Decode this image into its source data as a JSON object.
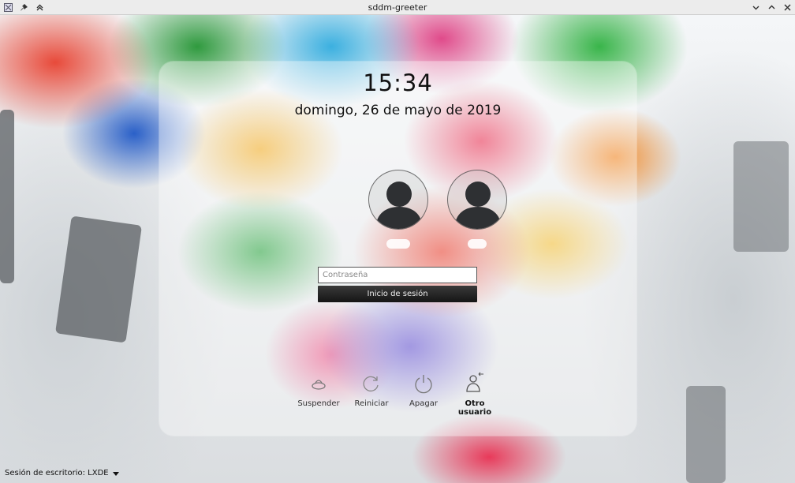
{
  "window": {
    "title": "sddm-greeter",
    "left_icons": [
      "app-menu-icon",
      "pin-icon",
      "keep-above-icon"
    ],
    "right_icons": [
      "minimize-chevron-icon",
      "maximize-chevron-icon",
      "close-icon"
    ]
  },
  "clock": {
    "time": "15:34",
    "date": "domingo, 26 de mayo de 2019"
  },
  "users": [
    {
      "icon": "user-avatar-icon",
      "name": ""
    },
    {
      "icon": "user-avatar-icon",
      "name": ""
    }
  ],
  "login": {
    "password_placeholder": "Contraseña",
    "password_value": "",
    "button_label": "Inicio de sesión"
  },
  "actions": [
    {
      "label": "Suspender",
      "icon": "suspend-icon"
    },
    {
      "label": "Reiniciar",
      "icon": "restart-icon"
    },
    {
      "label": "Apagar",
      "icon": "power-icon"
    },
    {
      "label": "Otro usuario",
      "icon": "other-user-icon"
    }
  ],
  "session": {
    "label": "Sesión de escritorio: LXDE",
    "icon": "dropdown-arrow-icon"
  }
}
